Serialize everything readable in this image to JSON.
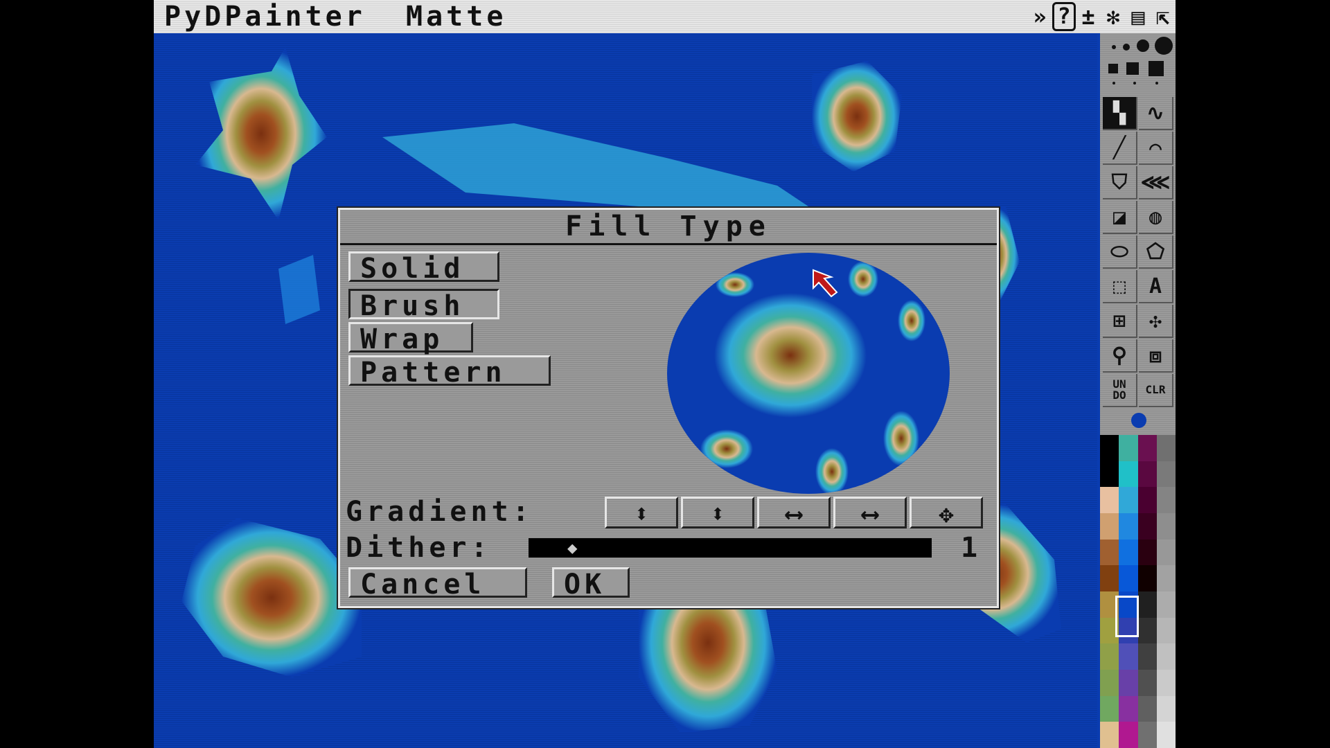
{
  "app": {
    "title": "PyDPainter",
    "menu_label": "Matte",
    "menu_icons": [
      "»",
      "?",
      "±",
      "✻",
      "▤",
      "⇱"
    ],
    "menu_icon_names": [
      "screen-toggle-icon",
      "help-icon",
      "coords-icon",
      "sparkle-icon",
      "menu-icon",
      "resize-icon"
    ]
  },
  "dialog": {
    "title": "Fill Type",
    "options": [
      "Solid",
      "Brush",
      "Wrap",
      "Pattern"
    ],
    "selected_option": "Brush",
    "gradient_label": "Gradient:",
    "gradient_buttons": [
      "⬍",
      "⬍",
      "⟷",
      "⟷",
      "✥"
    ],
    "gradient_button_names": [
      "vertical-gradient-icon",
      "vertical-contour-gradient-icon",
      "horizontal-gradient-icon",
      "horizontal-contour-gradient-icon",
      "radial-gradient-icon"
    ],
    "dither_label": "Dither:",
    "dither_value": "1",
    "cancel_label": "Cancel",
    "ok_label": "OK"
  },
  "toolbox": {
    "tools": [
      {
        "glyph": "▚",
        "name": "dotted-freehand-icon"
      },
      {
        "glyph": "∿",
        "name": "continuous-freehand-icon"
      },
      {
        "glyph": "╱",
        "name": "line-icon"
      },
      {
        "glyph": "⌒",
        "name": "curve-icon"
      },
      {
        "glyph": "⛉",
        "name": "fill-icon"
      },
      {
        "glyph": "⋘",
        "name": "airbrush-icon"
      },
      {
        "glyph": "◪",
        "name": "rectangle-icon"
      },
      {
        "glyph": "◍",
        "name": "circle-icon"
      },
      {
        "glyph": "⬭",
        "name": "ellipse-icon"
      },
      {
        "glyph": "⬠",
        "name": "polygon-icon"
      },
      {
        "glyph": "⬚",
        "name": "brush-select-icon"
      },
      {
        "glyph": "A",
        "name": "text-icon"
      },
      {
        "glyph": "⊞",
        "name": "grid-icon"
      },
      {
        "glyph": "✣",
        "name": "symmetry-icon"
      },
      {
        "glyph": "⚲",
        "name": "magnify-icon"
      },
      {
        "glyph": "⧈",
        "name": "zoom-icon"
      },
      {
        "glyph": "UN DO",
        "name": "undo-icon"
      },
      {
        "glyph": "CLR",
        "name": "clear-icon"
      }
    ],
    "palette": [
      "#000000",
      "#3fb0a0",
      "#6a1050",
      "#707070",
      "#000000",
      "#20c0c8",
      "#5a0840",
      "#7a7a7a",
      "#e8c0a0",
      "#30a8d8",
      "#4a0030",
      "#848484",
      "#d0a070",
      "#2088e0",
      "#3a0020",
      "#8e8e8e",
      "#a06030",
      "#1070e0",
      "#2a0010",
      "#989898",
      "#804010",
      "#0858d8",
      "#100000",
      "#a2a2a2",
      "#b09040",
      "#0848c8",
      "#202020",
      "#acacac",
      "#a0a040",
      "#3040b0",
      "#303030",
      "#b6b6b6",
      "#90a048",
      "#5050b8",
      "#404040",
      "#c0c0c0",
      "#80a050",
      "#6840a8",
      "#505050",
      "#cacaca",
      "#70a860",
      "#8830a0",
      "#606060",
      "#d4d4d4",
      "#e0c090",
      "#b01890",
      "#707070",
      "#e0e0e0"
    ]
  }
}
